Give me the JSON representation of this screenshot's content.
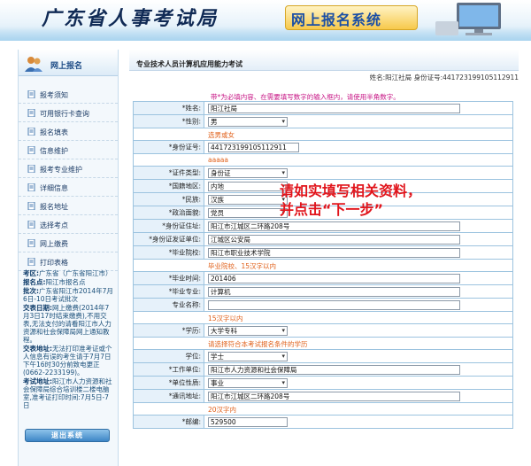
{
  "header": {
    "bureau_title": "广东省人事考试局",
    "banner": "网上报名系统"
  },
  "sidebar": {
    "title": "网上报名",
    "items": [
      {
        "label": "报考须知"
      },
      {
        "label": "可用银行卡查询"
      },
      {
        "label": "报名填表"
      },
      {
        "label": "信息维护"
      },
      {
        "label": "报考专业维护"
      },
      {
        "label": "详细信息"
      },
      {
        "label": "报名地址"
      },
      {
        "label": "选择考点"
      },
      {
        "label": "网上缴费"
      },
      {
        "label": "打印表格"
      }
    ],
    "info": [
      {
        "k": "考区:",
        "v": "广东省（广东省阳江市）"
      },
      {
        "k": "报名点:",
        "v": "阳江市报名点"
      },
      {
        "k": "批次:",
        "v": "广东省阳江市2014年7月6日-10日考试批次"
      },
      {
        "k": "交表日期:",
        "v": "网上缴费(2014年7月3日17时结束缴费),不用交表,无法支付的请看阳江市人力资源和社会保障局网上通知教程。"
      },
      {
        "k": "交表地址:",
        "v": "无法打印准考证或个人信息有误的考生请于7月7日下午16时30分前致电更正(0662-2233199)。"
      },
      {
        "k": "考试地址:",
        "v": "阳江市人力资源和社会保障局综合培训楼二楼电脑室,准考证打印时间:7月5日-7日"
      }
    ],
    "logout": "退出系统"
  },
  "main": {
    "title": "专业技术人员计算机应用能力考试",
    "user_line": "姓名:阳江社局  身份证号:441723199105112911",
    "notice": "带*为必填内容、在需要填写数字的输入框内，请使用半角数字。",
    "overlay_line1": "请如实填写相关资料，",
    "overlay_line2": "并点击“下一步”"
  },
  "form": {
    "name_label": "*姓名:",
    "name_value": "阳江社局",
    "gender_label": "*性别:",
    "gender_value": "男",
    "gender_hint": "选男或女",
    "id_label": "*身份证号:",
    "id_value": "441723199105112911",
    "id_hint": "aaaaa",
    "cert_label": "*证件类型:",
    "cert_value": "身份证",
    "region_label": "*国籍地区:",
    "region_value": "内地",
    "ethnic_label": "*民族:",
    "ethnic_value": "汉族",
    "political_label": "*政治面貌:",
    "political_value": "党员",
    "addr_label": "*身份证住址:",
    "addr_value": "阳江市江城区二环路208号",
    "issuer_label": "*身份证发证单位:",
    "issuer_value": "江城区公安局",
    "school_label": "*毕业院校:",
    "school_value": "阳江市职业技术学院",
    "school_hint": "毕业院校、15汉字以内",
    "gradtime_label": "*毕业时间:",
    "gradtime_value": "201406",
    "major_label": "*毕业专业:",
    "major_value": "计算机",
    "title_label": "专业名称:",
    "title_value": "",
    "title_hint": "15汉字以内",
    "edu_label": "*学历:",
    "edu_value": "大学专科",
    "edu_hint": "请选择符合本考试报名条件的学历",
    "degree_label": "学位:",
    "degree_value": "学士",
    "unit_label": "*工作单位:",
    "unit_value": "阳江市人力资源和社会保障局",
    "unittype_label": "*单位性质:",
    "unittype_value": "事业",
    "mail_label": "*通讯地址:",
    "mail_value": "阳江市江城区二环路208号",
    "mail_hint": "20汉字内",
    "zip_label": "*邮编:",
    "zip_value": "529500"
  },
  "colors": {
    "accent": "#1e4c86",
    "notice": "#c71585",
    "hint": "#e0601a",
    "overlay": "#e1141b"
  }
}
